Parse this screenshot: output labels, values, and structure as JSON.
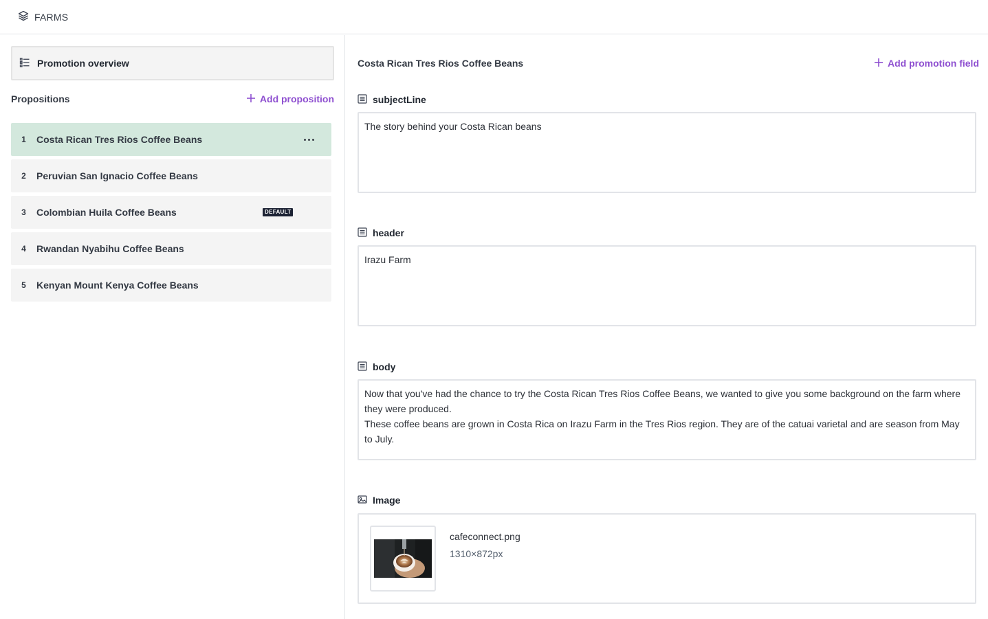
{
  "topbar": {
    "brand_label": "FARMS",
    "brand_icon": "layers-icon"
  },
  "left": {
    "overview_label": "Promotion overview",
    "propositions_title": "Propositions",
    "add_proposition_label": "Add proposition",
    "items": [
      {
        "num": "1",
        "label": "Costa Rican Tres Rios Coffee Beans",
        "active": true
      },
      {
        "num": "2",
        "label": "Peruvian San Ignacio Coffee Beans"
      },
      {
        "num": "3",
        "label": "Colombian Huila Coffee Beans",
        "badge": "DEFAULT"
      },
      {
        "num": "4",
        "label": "Rwandan Nyabihu Coffee Beans"
      },
      {
        "num": "5",
        "label": "Kenyan Mount Kenya Coffee Beans"
      }
    ]
  },
  "right": {
    "title": "Costa Rican Tres Rios Coffee Beans",
    "add_field_label": "Add promotion field",
    "fields": {
      "subject": {
        "label": "subjectLine",
        "value": "The story behind your Costa Rican beans"
      },
      "header": {
        "label": "header",
        "value": "Irazu Farm"
      },
      "body": {
        "label": "body",
        "line1": "Now that you've had the chance to try the Costa Rican Tres Rios Coffee Beans, we wanted to give you some background on the farm where they were produced.",
        "line2": "These coffee beans are grown in Costa Rica on Irazu Farm in the Tres Rios region. They are of the catuai varietal and are season from May to July."
      },
      "image": {
        "label": "Image",
        "filename": "cafeconnect.png",
        "dimensions": "1310×872px"
      }
    }
  },
  "colors": {
    "accent": "#8e4fd0",
    "active_row": "#d3e8dd",
    "row_bg": "#f4f4f4",
    "border": "#e2e4e8"
  }
}
